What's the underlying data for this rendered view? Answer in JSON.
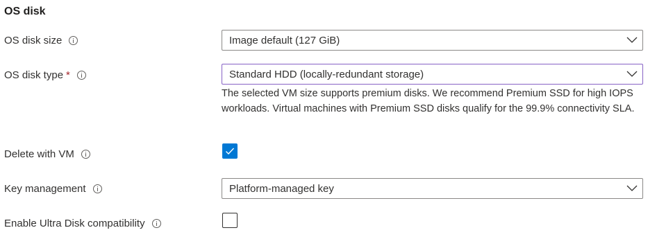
{
  "section": {
    "title": "OS disk"
  },
  "os_disk_size": {
    "label": "OS disk size",
    "value": "Image default (127 GiB)"
  },
  "os_disk_type": {
    "label": "OS disk type",
    "required_marker": "*",
    "value": "Standard HDD (locally-redundant storage)",
    "info_text": "The selected VM size supports premium disks. We recommend Premium SSD for high IOPS workloads. Virtual machines with Premium SSD disks qualify for the 99.9% connectivity SLA."
  },
  "delete_with_vm": {
    "label": "Delete with VM",
    "checked": true
  },
  "key_management": {
    "label": "Key management",
    "value": "Platform-managed key"
  },
  "ultra_disk": {
    "label": "Enable Ultra Disk compatibility",
    "checked": false
  },
  "colors": {
    "accent": "#0078d4",
    "required": "#a4262c",
    "focus_border": "#8661c5",
    "border": "#8a8886",
    "text": "#323130"
  },
  "icons": {
    "info": "info-icon",
    "chevron": "chevron-down-icon",
    "checkmark": "checkmark-icon"
  }
}
